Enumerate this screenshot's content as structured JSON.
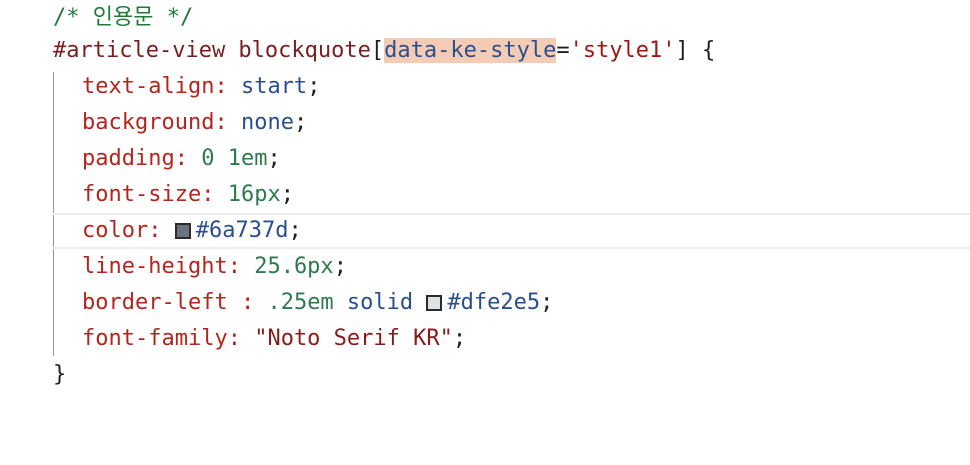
{
  "editor": {
    "comment": "/* 인용문 */",
    "selector_id": "#article-view blockquote",
    "bracket_open": "[",
    "attr_name": "data-ke-style",
    "equals": "=",
    "attr_value": "'style1'",
    "bracket_close": "]",
    "brace_open": " {",
    "brace_close": "}",
    "declarations": [
      {
        "prop": "text-align",
        "sep": ": ",
        "value": "start",
        "end": ";"
      },
      {
        "prop": "background",
        "sep": ": ",
        "value": "none",
        "end": ";"
      },
      {
        "prop": "padding",
        "sep": ": ",
        "value": "0 1em",
        "end": ";"
      },
      {
        "prop": "font-size",
        "sep": ": ",
        "value": "16px",
        "end": ";"
      },
      {
        "prop": "color",
        "sep": ": ",
        "value": "#6a737d",
        "end": ";",
        "swatch": "#6a737d"
      },
      {
        "prop": "line-height",
        "sep": ": ",
        "value": "25.6px",
        "end": ";"
      },
      {
        "prop": "border-left",
        "sep": " : ",
        "value_num": ".25em",
        "value_kw": " solid ",
        "value": "#dfe2e5",
        "end": ";",
        "swatch": "#dfe2e5"
      },
      {
        "prop": "font-family",
        "sep": ": ",
        "value": "\"Noto Serif KR\"",
        "end": ";"
      }
    ]
  }
}
